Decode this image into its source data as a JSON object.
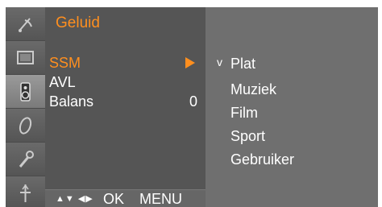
{
  "menu": {
    "title": "Geluid",
    "rows": [
      {
        "label": "SSM",
        "selected": true
      },
      {
        "label": "AVL"
      },
      {
        "label": "Balans",
        "value": "0"
      }
    ]
  },
  "submenu": {
    "items": [
      {
        "check": "v",
        "label": "Plat"
      },
      {
        "check": "",
        "label": "Muziek"
      },
      {
        "check": "",
        "label": "Film"
      },
      {
        "check": "",
        "label": "Sport"
      },
      {
        "check": "",
        "label": "Gebruiker"
      }
    ]
  },
  "nav": {
    "arrows": "▲▼ ◀▶",
    "ok": "OK",
    "menu": "MENU"
  },
  "icons": [
    "picture-icon",
    "sound-icon",
    "time-icon",
    "option-icon",
    "lock-icon",
    "input-icon"
  ],
  "colors": {
    "accent": "#ff8f1f",
    "panel": "#555555",
    "sub_panel": "#6f6f6f"
  }
}
